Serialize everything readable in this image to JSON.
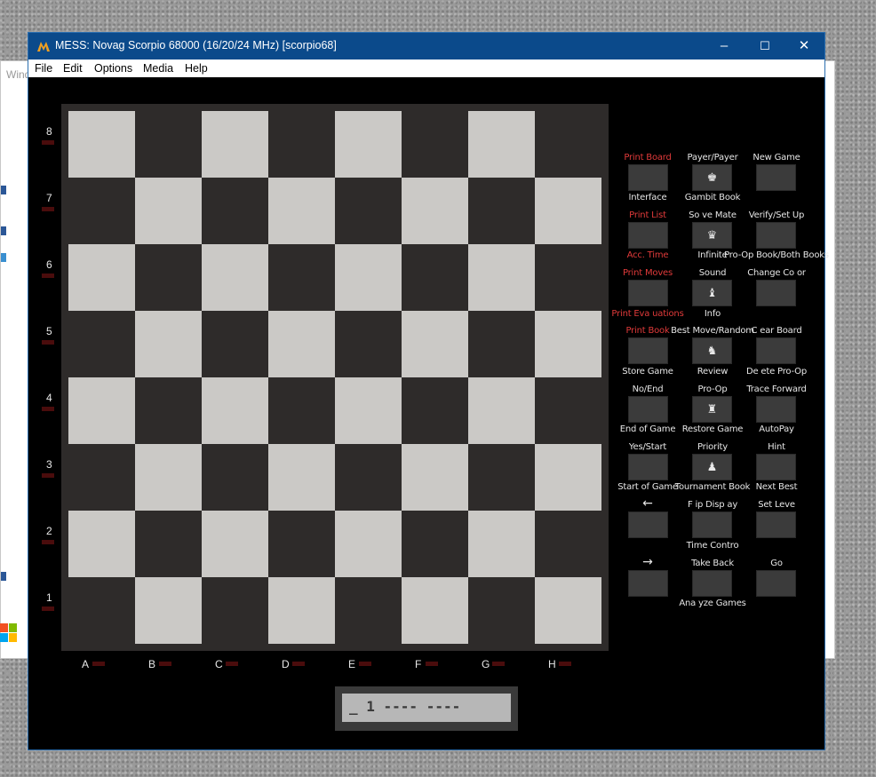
{
  "background_window": {
    "title_fragment": "Wind"
  },
  "window": {
    "title": "MESS: Novag Scorpio 68000 (16/20/24 MHz) [scorpio68]",
    "icon": "mess-logo-icon",
    "controls": {
      "minimize": "–",
      "maximize": "☐",
      "close": "✕"
    }
  },
  "menu": [
    "File",
    "Edit",
    "Options",
    "Media",
    "Help"
  ],
  "board": {
    "ranks": [
      "8",
      "7",
      "6",
      "5",
      "4",
      "3",
      "2",
      "1"
    ],
    "files": [
      "A",
      "B",
      "C",
      "D",
      "E",
      "F",
      "G",
      "H"
    ],
    "light_color": "#cbc9c6",
    "dark_color": "#2e2b2a"
  },
  "panel": {
    "r1": {
      "top": [
        "Print Board",
        "Payer/Payer",
        "New Game"
      ],
      "bottom": [
        "Interface",
        "Gambit Book",
        ""
      ]
    },
    "r2": {
      "top": [
        "Print List",
        "So ve Mate",
        "Verify/Set Up"
      ],
      "bottom": [
        "Acc. Time",
        "Infinite",
        "Pro-Op Book/Both Books"
      ]
    },
    "r3": {
      "top": [
        "Print Moves",
        "Sound",
        "Change Co or"
      ],
      "bottom": [
        "Print Eva uations",
        "Info",
        ""
      ]
    },
    "r4": {
      "top": [
        "Print Book",
        "Best Move/Random",
        "C ear Board"
      ],
      "bottom": [
        "Store Game",
        "Review",
        "De ete Pro-Op"
      ]
    },
    "r5": {
      "top": [
        "No/End",
        "Pro-Op",
        "Trace Forward"
      ],
      "bottom": [
        "End of Game",
        "Restore Game",
        "AutoPay"
      ]
    },
    "r6": {
      "top": [
        "Yes/Start",
        "Priority",
        "Hint"
      ],
      "bottom": [
        "Start of Game",
        "Tournament Book",
        "Next Best"
      ]
    },
    "r7": {
      "top": [
        "←",
        "F ip Disp ay",
        "Set Leve"
      ],
      "bottom": [
        "",
        "Time Contro",
        ""
      ]
    },
    "r8": {
      "top": [
        "→",
        "Take Back",
        "Go"
      ],
      "bottom": [
        "",
        "Ana yze Games",
        ""
      ]
    },
    "pieces": [
      "♚",
      "♛",
      "♝",
      "♞",
      "♜",
      "♟"
    ],
    "red_color": "#e03a3a"
  },
  "lcd": {
    "text": "_ 1 ---- ----"
  }
}
